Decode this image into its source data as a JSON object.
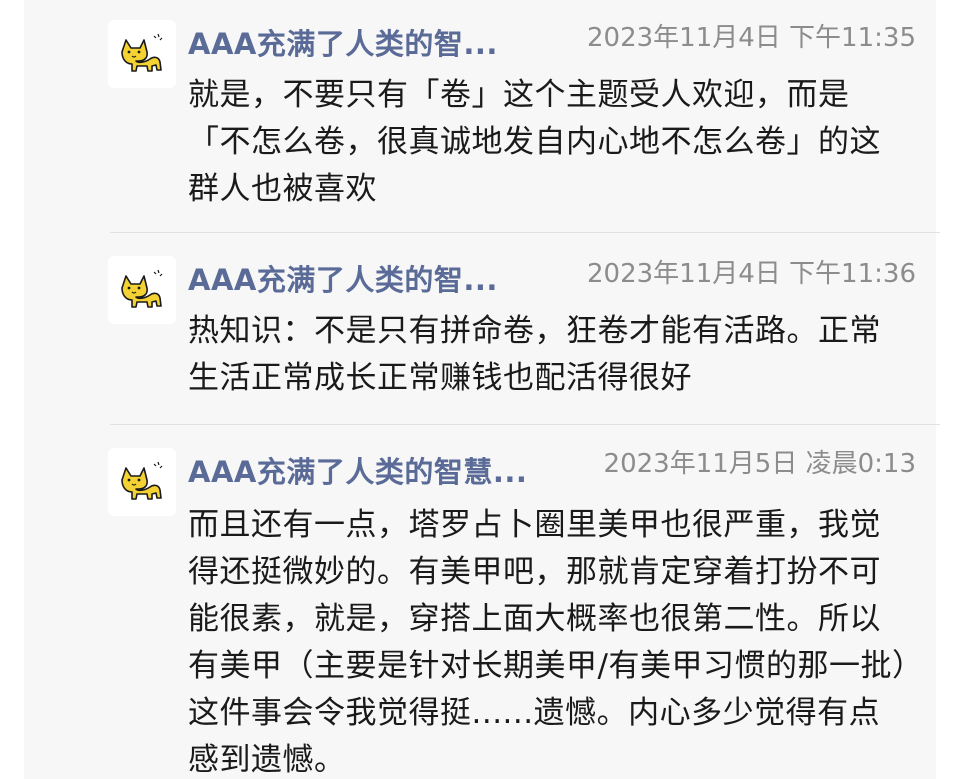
{
  "messages": [
    {
      "sender": "AAA充满了人类的智...",
      "time": "2023年11月4日 下午11:35",
      "text": "就是，不要只有「卷」这个主题受人欢迎，而是「不怎么卷，很真诚地发自内心地不怎么卷」的这群人也被喜欢",
      "avatar_icon": "yellow-cat-icon"
    },
    {
      "sender": "AAA充满了人类的智...",
      "time": "2023年11月4日 下午11:36",
      "text": "热知识：不是只有拼命卷，狂卷才能有活路。正常生活正常成长正常赚钱也配活得很好",
      "avatar_icon": "yellow-cat-icon"
    },
    {
      "sender": "AAA充满了人类的智慧...",
      "time": "2023年11月5日 凌晨0:13",
      "text": "而且还有一点，塔罗占卜圈里美甲也很严重，我觉得还挺微妙的。有美甲吧，那就肯定穿着打扮不可能很素，就是，穿搭上面大概率也很第二性。所以有美甲（主要是针对长期美甲/有美甲习惯的那一批）这件事会令我觉得挺......遗憾。内心多少觉得有点感到遗憾。",
      "avatar_icon": "yellow-cat-icon"
    }
  ],
  "colors": {
    "background": "#ffffff",
    "panel": "#f7f7f7",
    "sender_name": "#5b6b98",
    "timestamp": "#8c8c8c",
    "body_text": "#1a1a1a",
    "divider": "#e2e2e2",
    "avatar_cat": "#f5d233"
  }
}
